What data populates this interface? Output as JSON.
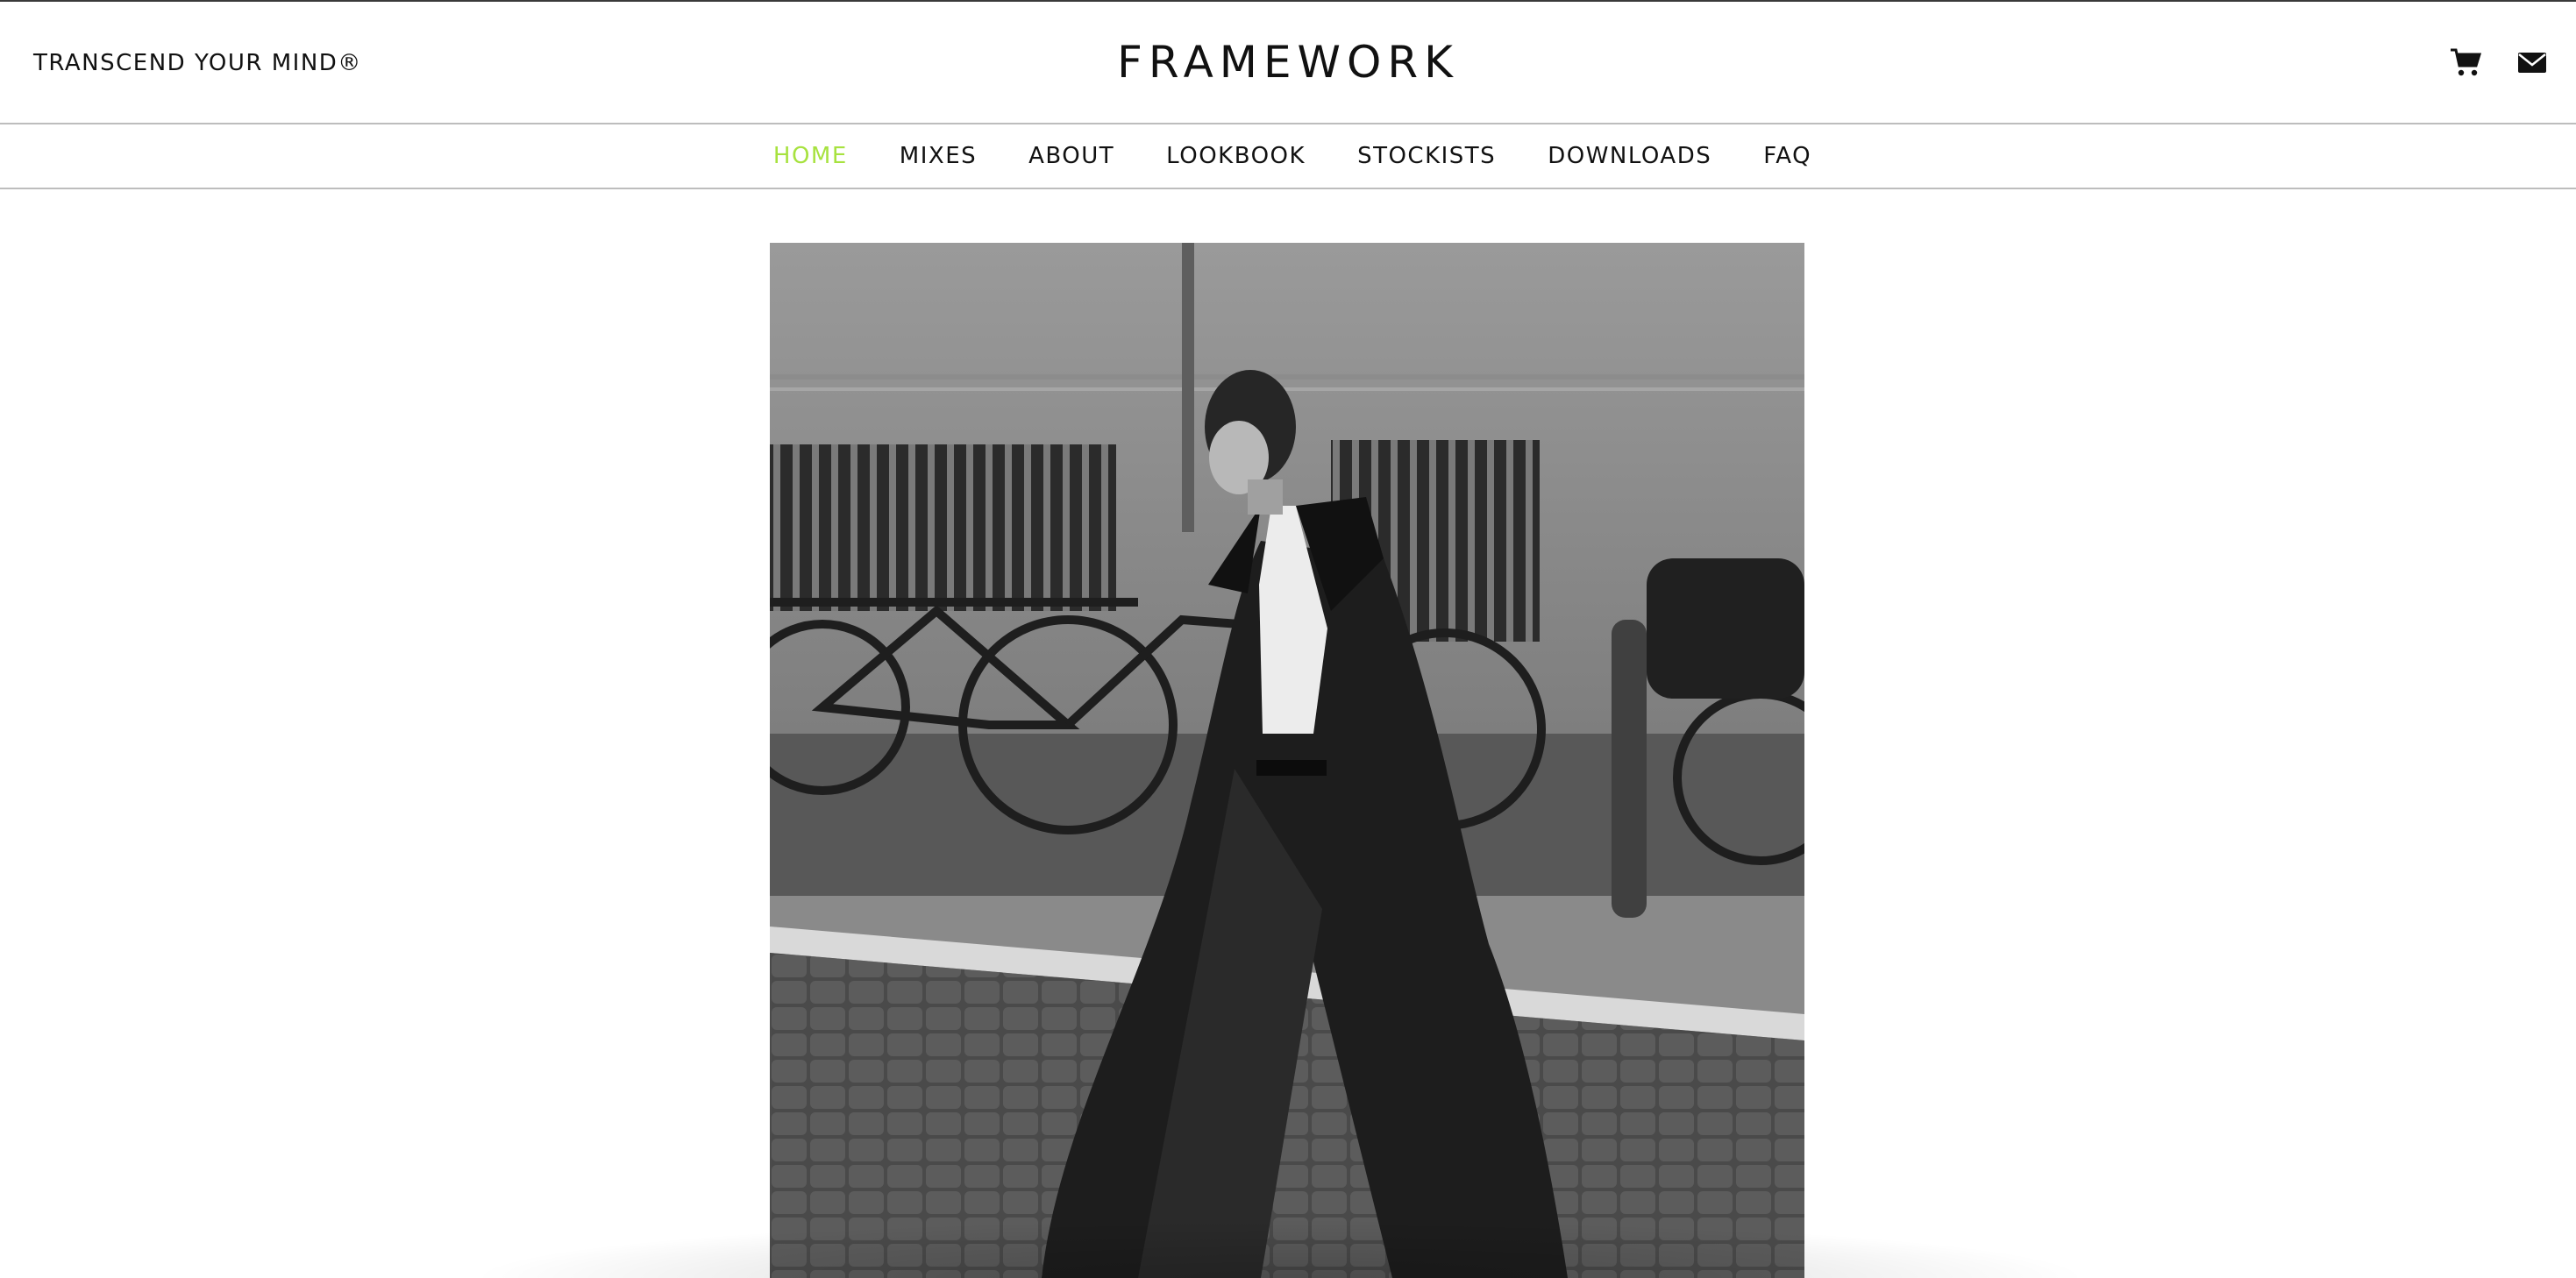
{
  "header": {
    "tagline": "TRANSCEND YOUR MIND®",
    "brand": "FRAMEWORK",
    "icons": [
      "cart-icon",
      "mail-icon"
    ]
  },
  "nav": {
    "items": [
      {
        "label": "HOME",
        "active": true
      },
      {
        "label": "MIXES",
        "active": false
      },
      {
        "label": "ABOUT",
        "active": false
      },
      {
        "label": "LOOKBOOK",
        "active": false
      },
      {
        "label": "STOCKISTS",
        "active": false
      },
      {
        "label": "DOWNLOADS",
        "active": false
      },
      {
        "label": "FAQ",
        "active": false
      }
    ]
  },
  "hero": {
    "image": "black-and-white-photo-man-in-long-coat-walking-on-cobblestone-street"
  },
  "colors": {
    "accent": "#a7e23f",
    "text": "#111111",
    "divider": "#bdbdbd"
  }
}
